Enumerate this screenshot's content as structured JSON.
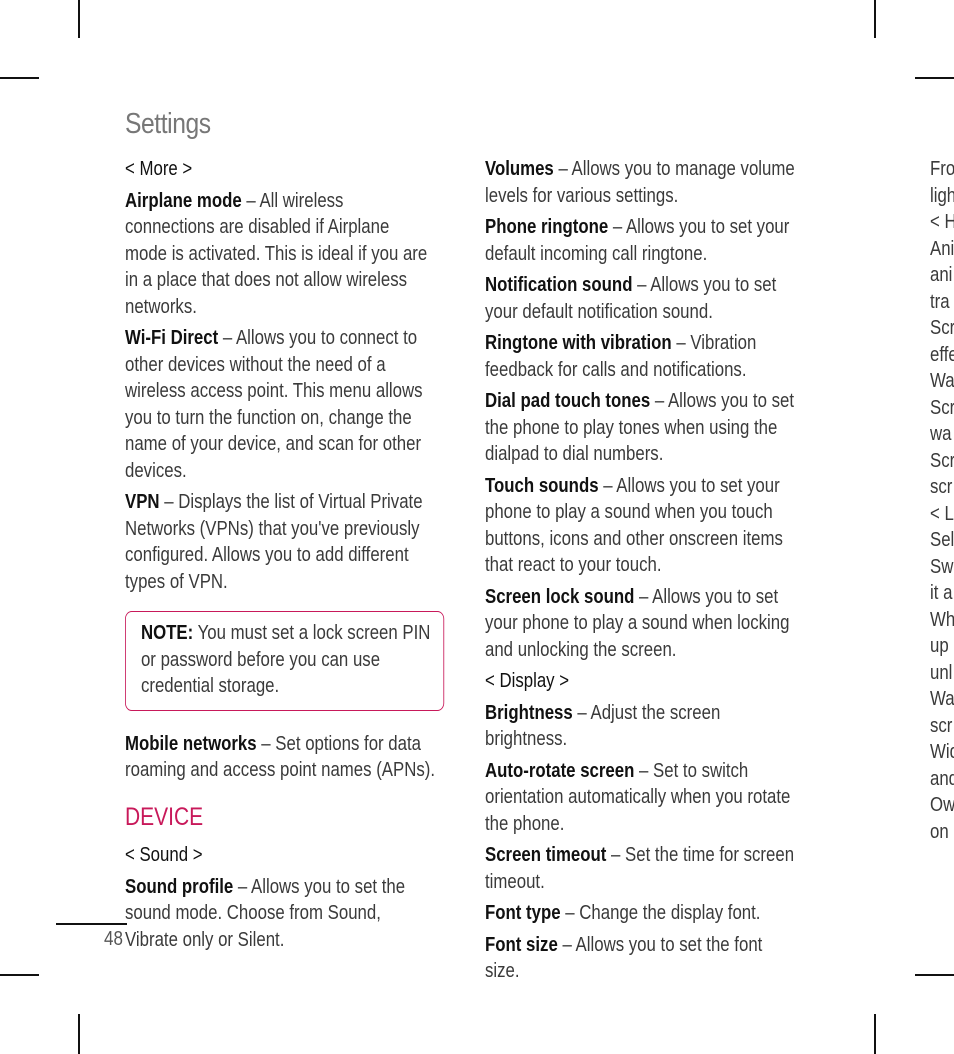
{
  "page": {
    "title": "Settings",
    "page_number": "48",
    "accent_color": "#c8195a"
  },
  "col1": {
    "more_header": "< More >",
    "entries_a": [
      {
        "term": "Airplane mode",
        "desc": " – All wireless connections are disabled if Airplane mode is activated. This is ideal if you are in a place that does not allow wireless networks."
      },
      {
        "term": "Wi-Fi Direct",
        "desc": " – Allows you to connect to other devices without the need of a wireless access point. This menu allows you to turn the function on, change the name of your device, and scan for other devices."
      },
      {
        "term": "VPN",
        "desc": " – Displays the list of Virtual Private Networks (VPNs) that you've previously configured. Allows you to add different types of VPN."
      }
    ],
    "note": {
      "label": "NOTE:",
      "text": " You must set a lock screen PIN or password before you can use credential storage."
    },
    "entries_b": [
      {
        "term": "Mobile networks",
        "desc": " – Set options for data roaming and access point names (APNs)."
      }
    ],
    "device_heading": "DEVICE",
    "sound_header": "< Sound >",
    "entries_c": [
      {
        "term": "Sound profile",
        "desc": " – Allows you to set the sound mode. Choose from Sound, Vibrate only or Silent."
      }
    ]
  },
  "col2": {
    "entries_a": [
      {
        "term": "Volumes",
        "desc": " – Allows you to manage volume levels for various settings."
      },
      {
        "term": "Phone ringtone",
        "desc": " – Allows you to set your default incoming call ringtone."
      },
      {
        "term": "Notification sound",
        "desc": " – Allows you to set your default notification sound."
      },
      {
        "term": "Ringtone with vibration",
        "desc": " – Vibration feedback for calls and notifications."
      },
      {
        "term": "Dial pad touch tones",
        "desc": " – Allows you to set the phone to play tones when using the dialpad to dial numbers."
      },
      {
        "term": "Touch sounds",
        "desc": " – Allows you to set your phone to play a sound when you touch buttons, icons and other onscreen items that react to your touch."
      },
      {
        "term": "Screen lock sound",
        "desc": " – Allows you to set your phone to play a sound when locking and unlocking the screen."
      }
    ],
    "display_header": "< Display >",
    "entries_b": [
      {
        "term": "Brightness",
        "desc": " – Adjust the screen brightness."
      },
      {
        "term": "Auto-rotate screen",
        "desc": " – Set to switch orientation automatically when you rotate the phone."
      },
      {
        "term": "Screen timeout",
        "desc": " – Set the time for screen timeout."
      },
      {
        "term": "Font type",
        "desc": " – Change the display font."
      },
      {
        "term": "Font size",
        "desc": " – Allows you to set the font size."
      }
    ]
  },
  "col3": {
    "lines": [
      "Fro",
      "ligh",
      "< H",
      "Ani",
      "ani",
      "tra",
      "Scr",
      "effe",
      "Wa",
      "Scr",
      "wa",
      "Scr",
      "scr",
      "< L",
      "Sel",
      "Sw",
      "it a",
      "Wh",
      "up",
      "unl",
      "Wa",
      "scr",
      "Wid",
      "and",
      "Ow",
      "on"
    ]
  }
}
